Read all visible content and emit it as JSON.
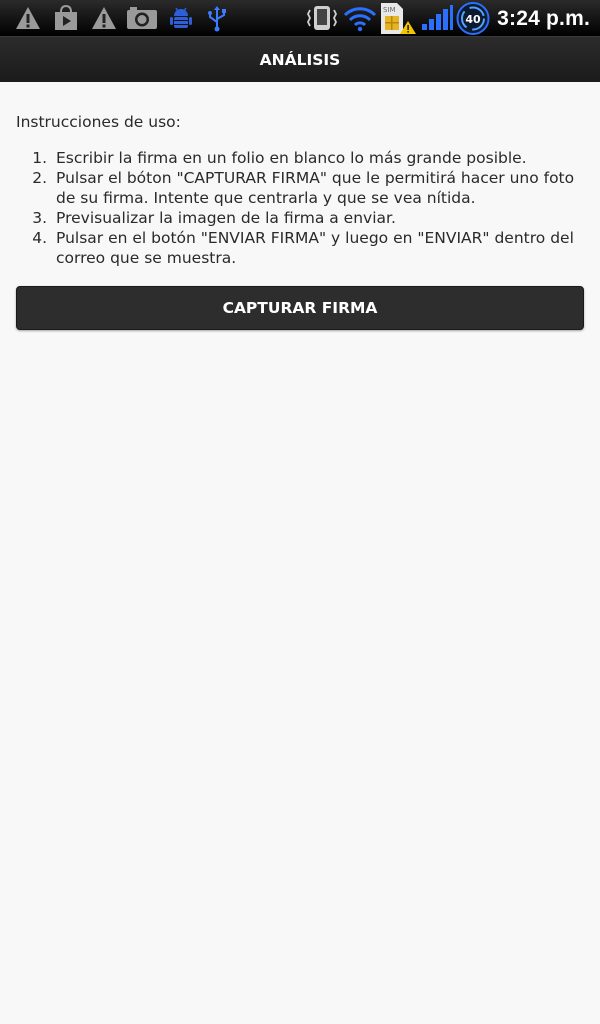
{
  "status_bar": {
    "time": "3:24 p.m.",
    "sim_label": "SIM",
    "network_badge": "40",
    "icons_left": [
      "warning-icon",
      "play-store-icon",
      "warning-icon",
      "camera-icon",
      "android-debug-icon",
      "usb-icon"
    ],
    "icons_right": [
      "vibrate-icon",
      "wifi-icon",
      "sim-warning-icon",
      "signal-icon",
      "data-badge-icon"
    ]
  },
  "title_bar": {
    "title": "ANÁLISIS"
  },
  "main": {
    "intro": "Instrucciones de uso:",
    "steps": [
      {
        "number": "1.",
        "text": "Escribir la firma en un folio en blanco lo más grande posible."
      },
      {
        "number": "2.",
        "text": "Pulsar el bóton \"CAPTURAR FIRMA\" que le permitirá hacer uno foto de su firma. Intente que centrarla y que se vea nítida."
      },
      {
        "number": "3.",
        "text": "Previsualizar la imagen de la firma a enviar."
      },
      {
        "number": "4.",
        "text": "Pulsar en el botón \"ENVIAR FIRMA\" y luego en \"ENVIAR\" dentro del correo que se muestra."
      }
    ],
    "capture_button_label": "CAPTURAR FIRMA"
  },
  "colors": {
    "background": "#f8f8f8",
    "bar": "#1f1f1f",
    "button": "#2d2d2d",
    "accent_blue": "#3a7bff"
  }
}
